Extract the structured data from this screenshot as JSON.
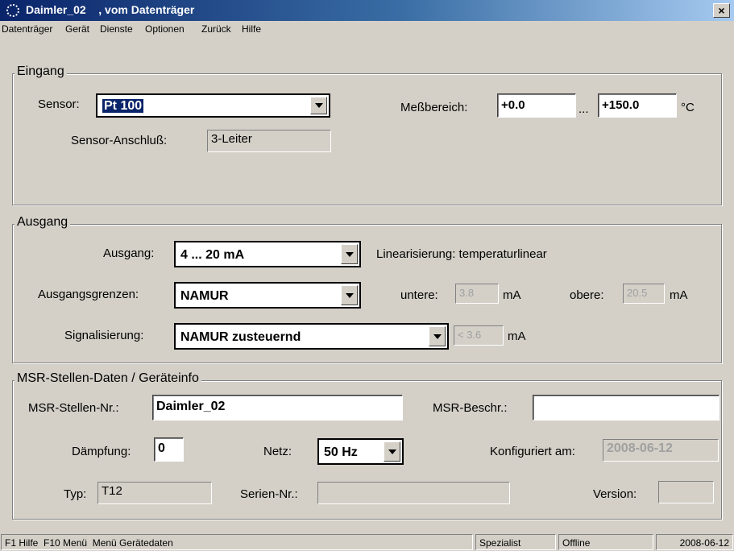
{
  "window": {
    "title": "Daimler_02    , vom Datenträger",
    "close_label": "×"
  },
  "menu": [
    "Datenträger",
    "Gerät",
    "Dienste",
    "Optionen",
    "Zurück",
    "Hilfe"
  ],
  "eingang": {
    "legend": "Eingang",
    "sensor_label": "Sensor:",
    "sensor_value": "Pt 100",
    "messbereich_label": "Meßbereich:",
    "range_from": "+0.0",
    "range_sep": "...",
    "range_to": "+150.0",
    "range_unit": "°C",
    "anschluss_label": "Sensor-Anschluß:",
    "anschluss_value": "3-Leiter"
  },
  "ausgang": {
    "legend": "Ausgang",
    "ausgang_label": "Ausgang:",
    "ausgang_value": "4 ... 20 mA",
    "linearisierung": "Linearisierung: temperaturlinear",
    "grenzen_label": "Ausgangsgrenzen:",
    "grenzen_value": "NAMUR",
    "untere_label": "untere:",
    "untere_value": "3.8",
    "untere_unit": "mA",
    "obere_label": "obere:",
    "obere_value": "20.5",
    "obere_unit": "mA",
    "signal_label": "Signalisierung:",
    "signal_value": "NAMUR zusteuernd",
    "signal_limit": "< 3.6",
    "signal_unit": "mA"
  },
  "msr": {
    "legend": "MSR-Stellen-Daten / Geräteinfo",
    "nr_label": "MSR-Stellen-Nr.:",
    "nr_value": "Daimler_02",
    "beschr_label": "MSR-Beschr.:",
    "beschr_value": "",
    "daempfung_label": "Dämpfung:",
    "daempfung_value": "0",
    "netz_label": "Netz:",
    "netz_value": "50 Hz",
    "konfig_label": "Konfiguriert am:",
    "konfig_value": "2008-06-12",
    "typ_label": "Typ:",
    "typ_value": "T12",
    "serien_label": "Serien-Nr.:",
    "serien_value": "",
    "version_label": "Version:",
    "version_value": ""
  },
  "statusbar": {
    "help": "F1 Hilfe  F10 Menü  Menü Gerätedaten",
    "role": "Spezialist",
    "mode": "Offline",
    "date": "2008-06-12"
  },
  "colors": {
    "titlebar": "#0a246a",
    "face": "#d4d0c8",
    "selection": "#0a246a"
  }
}
